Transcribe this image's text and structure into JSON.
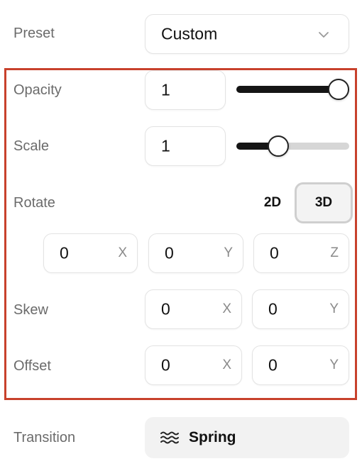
{
  "preset": {
    "label": "Preset",
    "value": "Custom"
  },
  "opacity": {
    "label": "Opacity",
    "value": "1",
    "slider_level": 1.0
  },
  "scale": {
    "label": "Scale",
    "value": "1",
    "slider_level": 0.34
  },
  "rotate": {
    "label": "Rotate",
    "modes": [
      "2D",
      "3D"
    ],
    "selected_mode": "3D",
    "x": {
      "value": "0",
      "axis": "X"
    },
    "y": {
      "value": "0",
      "axis": "Y"
    },
    "z": {
      "value": "0",
      "axis": "Z"
    }
  },
  "skew": {
    "label": "Skew",
    "x": {
      "value": "0",
      "axis": "X"
    },
    "y": {
      "value": "0",
      "axis": "Y"
    }
  },
  "offset": {
    "label": "Offset",
    "x": {
      "value": "0",
      "axis": "X"
    },
    "y": {
      "value": "0",
      "axis": "Y"
    }
  },
  "transition": {
    "label": "Transition",
    "value": "Spring",
    "icon": "wave-icon"
  },
  "colors": {
    "highlight": "#c8412c",
    "slider_fill": "#151515",
    "slider_track": "#d6d6d6"
  }
}
